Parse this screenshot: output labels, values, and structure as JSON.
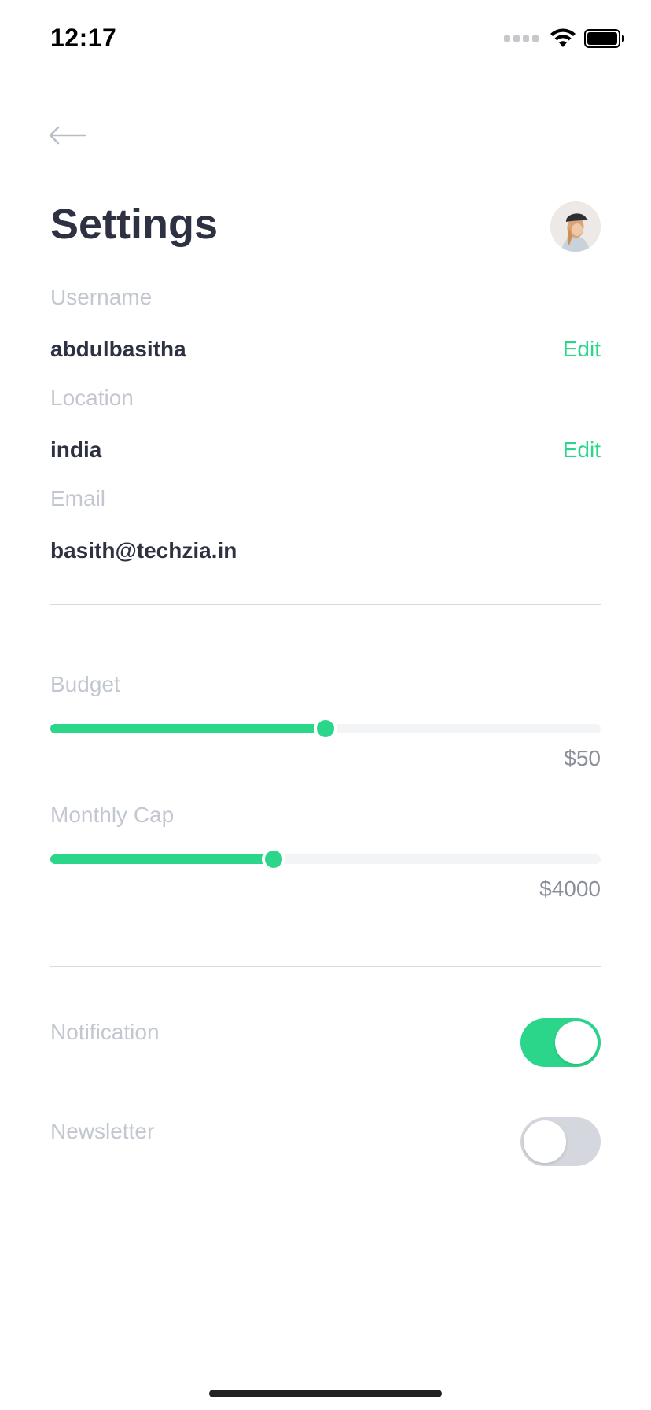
{
  "status_bar": {
    "time": "12:17"
  },
  "page": {
    "title": "Settings"
  },
  "profile": {
    "username_label": "Username",
    "username_value": "abdulbasitha",
    "username_edit": "Edit",
    "location_label": "Location",
    "location_value": "india",
    "location_edit": "Edit",
    "email_label": "Email",
    "email_value": "basith@techzia.in"
  },
  "sliders": {
    "budget": {
      "label": "Budget",
      "value_text": "$50",
      "level": 0.5
    },
    "monthly_cap": {
      "label": "Monthly Cap",
      "value_text": "$4000",
      "level": 0.405
    }
  },
  "toggles": {
    "notification": {
      "label": "Notification",
      "on": true
    },
    "newsletter": {
      "label": "Newsletter",
      "on": false
    }
  },
  "colors": {
    "accent": "#2bd68b",
    "title": "#2e3142",
    "label": "#c3c7d0"
  }
}
